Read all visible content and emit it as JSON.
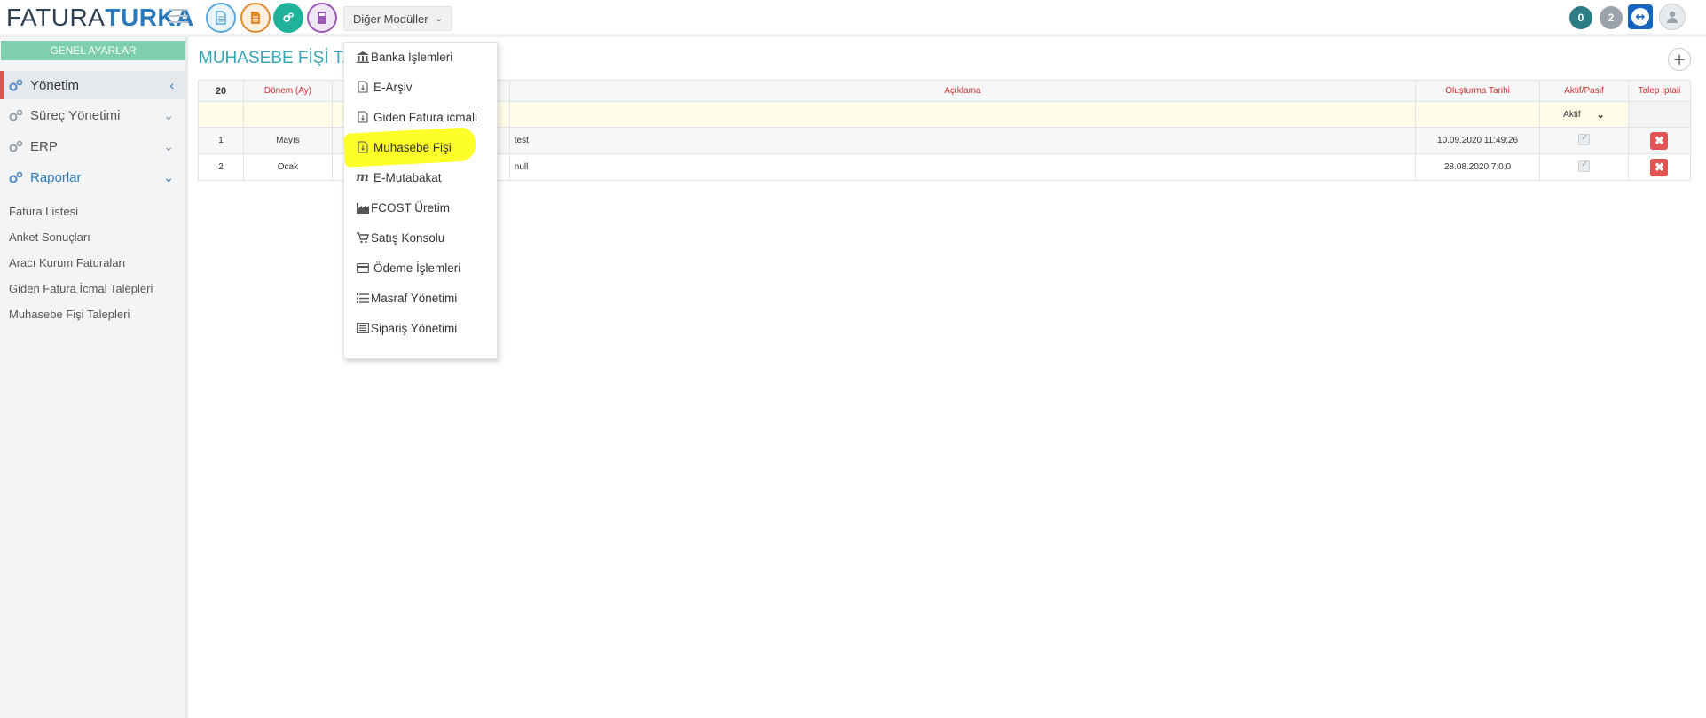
{
  "app": {
    "logo_part1": "FATURA",
    "logo_part2": "TURKA"
  },
  "topbar": {
    "modules_label": "Diğer Modüller",
    "notifications_count": "0",
    "messages_count": "2"
  },
  "sidebar": {
    "header": "GENEL AYARLAR",
    "items": [
      {
        "label": "Yönetim"
      },
      {
        "label": "Süreç Yönetimi"
      },
      {
        "label": "ERP"
      },
      {
        "label": "Raporlar"
      }
    ],
    "sub_items": [
      "Fatura Listesi",
      "Anket Sonuçları",
      "Aracı Kurum Faturaları",
      "Giden Fatura İcmal Talepleri",
      "Muhasebe Fişi Talepleri"
    ]
  },
  "main": {
    "title": "MUHASEBE FİŞİ TA",
    "table": {
      "headers": {
        "count": "20",
        "donem": "Dönem (Ay)",
        "aciklama": "Açıklama",
        "olusturma": "Oluşturma Tarihi",
        "aktif": "Aktif/Pasif",
        "talep": "Talep İptali"
      },
      "filter_aktif": "Aktif",
      "rows": [
        {
          "no": "1",
          "donem": "Mayıs",
          "aciklama": "test",
          "tarih": "10.09.2020 11:49:26"
        },
        {
          "no": "2",
          "donem": "Ocak",
          "aciklama": "null",
          "tarih": "28.08.2020 7:0:0"
        }
      ]
    }
  },
  "dropdown": {
    "items": [
      {
        "label": "Banka İşlemleri",
        "icon": "bank-icon"
      },
      {
        "label": "E-Arşiv",
        "icon": "document-icon"
      },
      {
        "label": "Giden Fatura icmali",
        "icon": "document-icon"
      },
      {
        "label": "Muhasebe Fişi",
        "icon": "document-icon"
      },
      {
        "label": "E-Mutabakat",
        "icon": "m-icon"
      },
      {
        "label": "FCOST Üretim",
        "icon": "factory-icon"
      },
      {
        "label": "Satış Konsolu",
        "icon": "cart-icon"
      },
      {
        "label": "Ödeme İşlemleri",
        "icon": "credit-card-icon"
      },
      {
        "label": "Masraf Yönetimi",
        "icon": "list-icon"
      },
      {
        "label": "Sipariş Yönetimi",
        "icon": "list-alt-icon"
      }
    ]
  },
  "colors": {
    "accent": "#2a7bbd",
    "title": "#37a4b8",
    "header_green": "#7ecfae",
    "danger": "#e05454",
    "highlight": "#ffff2a"
  }
}
